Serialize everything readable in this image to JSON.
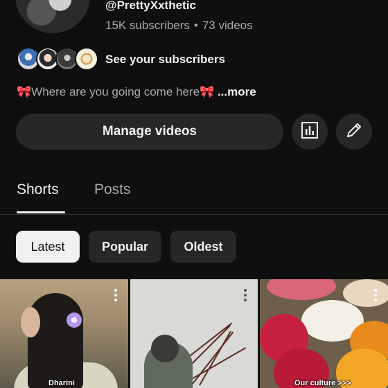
{
  "channel": {
    "handle": "@PrettyXxthetic",
    "subscribers": "15K subscribers",
    "separator": "•",
    "videos": "73 videos",
    "see_subscribers": "See your subscribers",
    "description": "🎀Where are you going come here🎀",
    "more": "...more"
  },
  "actions": {
    "manage_videos": "Manage videos",
    "analytics_icon": "bar-chart-icon",
    "edit_icon": "pencil-icon"
  },
  "tabs": [
    {
      "label": "Shorts",
      "active": true
    },
    {
      "label": "Posts",
      "active": false
    }
  ],
  "filters": [
    {
      "label": "Latest",
      "active": true
    },
    {
      "label": "Popular",
      "active": false
    },
    {
      "label": "Oldest",
      "active": false
    }
  ],
  "shorts": [
    {
      "caption": "Dharini"
    },
    {
      "caption": ""
    },
    {
      "caption": "Our culture >>>"
    }
  ]
}
